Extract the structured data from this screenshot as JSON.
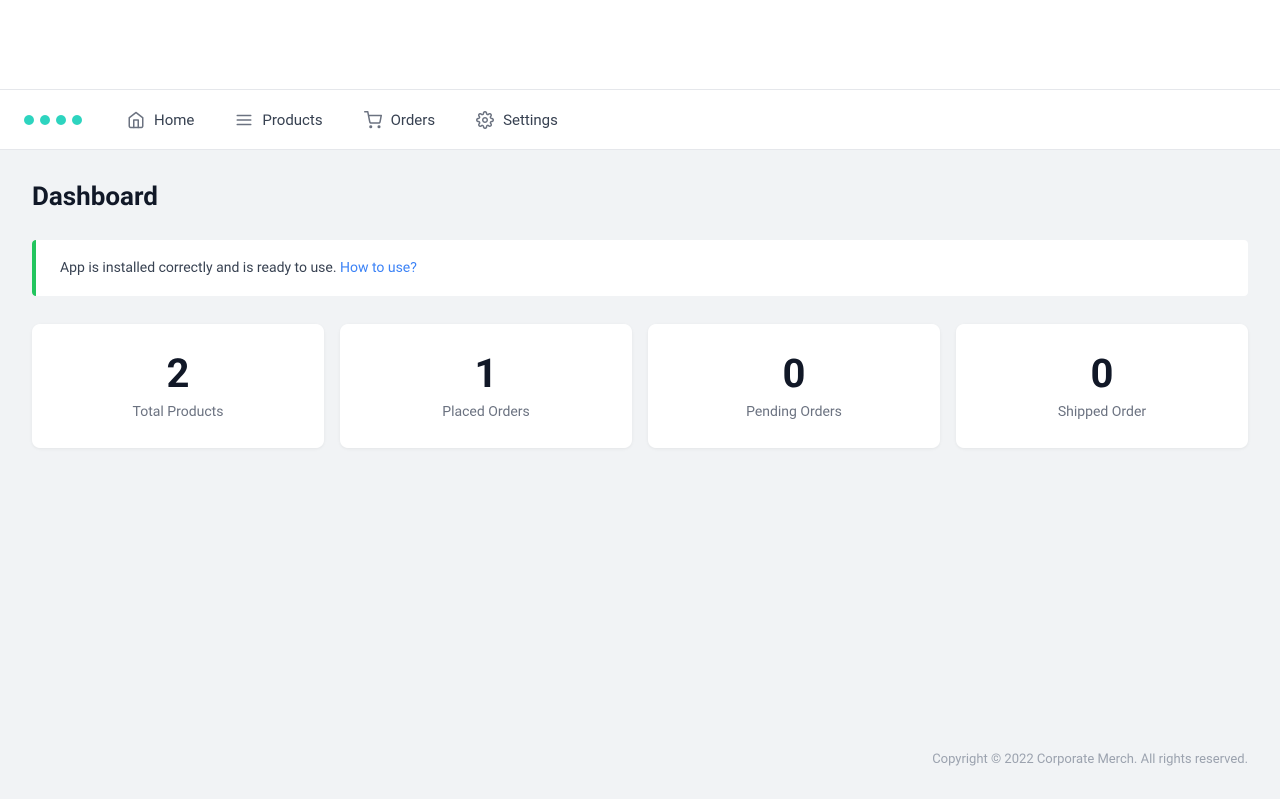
{
  "topSpacer": {},
  "navbar": {
    "dots": [
      "dot1",
      "dot2",
      "dot3",
      "dot4"
    ],
    "items": [
      {
        "id": "home",
        "label": "Home",
        "icon": "home-icon"
      },
      {
        "id": "products",
        "label": "Products",
        "icon": "list-icon"
      },
      {
        "id": "orders",
        "label": "Orders",
        "icon": "cart-icon"
      },
      {
        "id": "settings",
        "label": "Settings",
        "icon": "gear-icon"
      }
    ]
  },
  "dashboard": {
    "title": "Dashboard",
    "banner": {
      "text": "App is installed correctly and is ready to use.",
      "linkText": "How to use?",
      "linkHref": "#"
    },
    "stats": [
      {
        "id": "total-products",
        "number": "2",
        "label": "Total Products"
      },
      {
        "id": "placed-orders",
        "number": "1",
        "label": "Placed Orders"
      },
      {
        "id": "pending-orders",
        "number": "0",
        "label": "Pending Orders"
      },
      {
        "id": "shipped-order",
        "number": "0",
        "label": "Shipped Order"
      }
    ]
  },
  "footer": {
    "text": "Copyright © 2022 Corporate Merch. All rights reserved."
  }
}
